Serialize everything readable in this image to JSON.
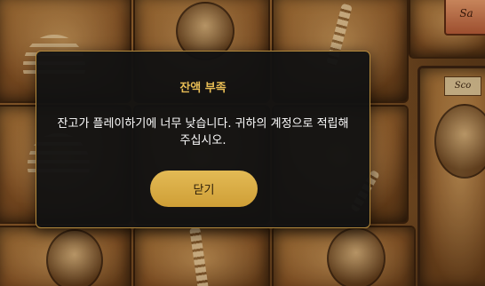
{
  "background": {
    "sign_text_top": "Sa",
    "sign_text_side": "Sco"
  },
  "dialog": {
    "title": "잔액 부족",
    "message": "잔고가 플레이하기에 너무 낮습니다. 귀하의 계정으로 적립해 주십시오.",
    "close_label": "닫기"
  },
  "colors": {
    "title": "#e8bd55",
    "button": "#d8ac45",
    "modal_bg": "#121212",
    "modal_border": "#b58a3c"
  }
}
